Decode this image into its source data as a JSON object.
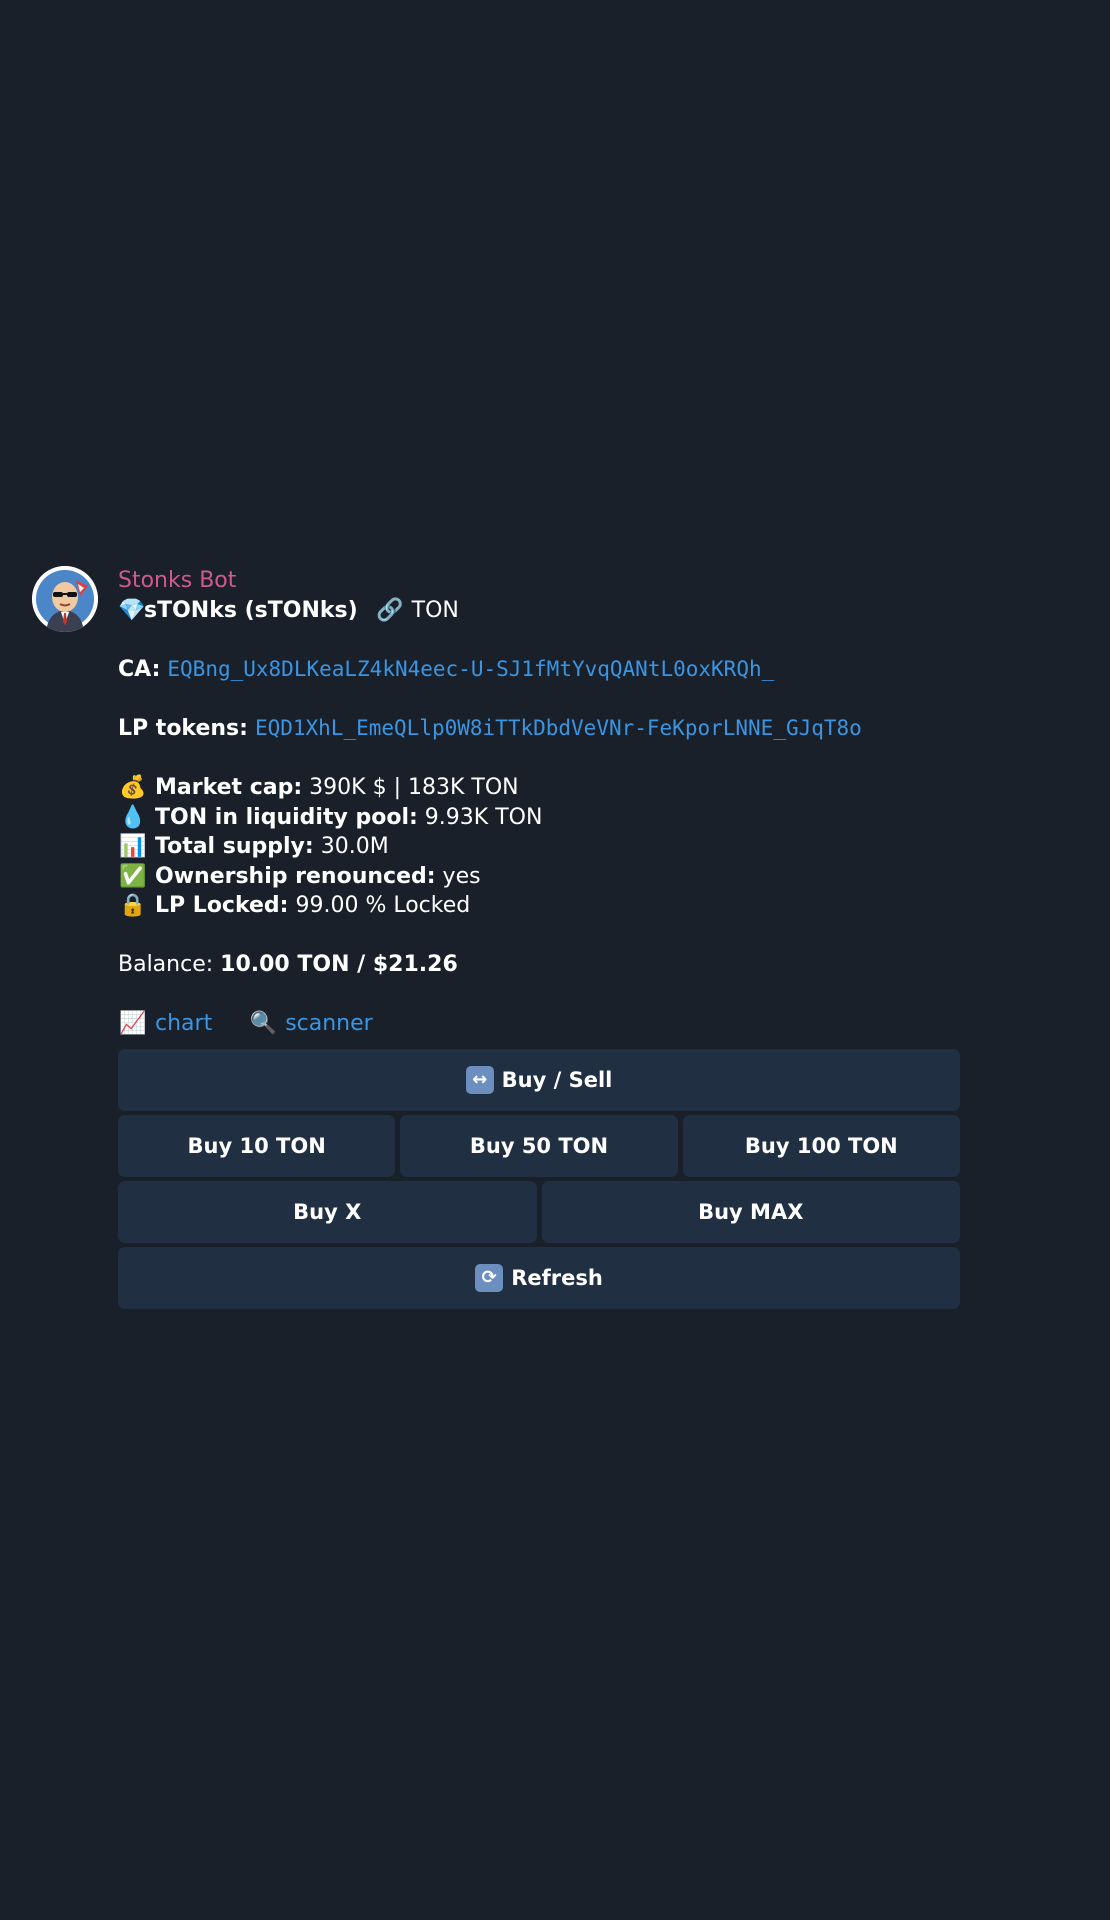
{
  "message": {
    "sender": "Stonks Bot",
    "token_name": "sTONks (sTONks)",
    "network": "TON",
    "ca_label": "CA:",
    "ca_value": "EQBng_Ux8DLKeaLZ4kN4eec-U-SJ1fMtYvqQANtL0oxKRQh_",
    "lp_label": "LP tokens:",
    "lp_value": "EQD1XhL_EmeQLlp0W8iTTkDbdVeVNr-FeKporLNNE_GJqT8o",
    "stats": [
      {
        "icon": "money-bag-icon",
        "glyph": "💰",
        "label": "Market cap:",
        "value": "390K $ | 183K TON"
      },
      {
        "icon": "droplet-icon",
        "glyph": "💧",
        "label": "TON in liquidity pool:",
        "value": "9.93K TON"
      },
      {
        "icon": "bar-chart-icon",
        "glyph": "📊",
        "label": "Total supply:",
        "value": "30.0M"
      },
      {
        "icon": "check-mark-icon",
        "glyph": "✅",
        "label": "Ownership renounced:",
        "value": "yes"
      },
      {
        "icon": "lock-icon",
        "glyph": "🔒",
        "label": "LP Locked:",
        "value": "99.00 % Locked"
      }
    ],
    "balance_label": "Balance:",
    "balance_value": "10.00 TON / $21.26",
    "links": {
      "chart_label": "chart",
      "scanner_label": "scanner"
    }
  },
  "buttons": {
    "buy_sell": "Buy / Sell",
    "buy_10": "Buy 10 TON",
    "buy_50": "Buy 50 TON",
    "buy_100": "Buy 100 TON",
    "buy_x": "Buy X",
    "buy_max": "Buy MAX",
    "refresh": "Refresh"
  },
  "colors": {
    "background": "#19202a",
    "sender": "#d05a8c",
    "link": "#3a95e3",
    "button": "#212f42"
  }
}
